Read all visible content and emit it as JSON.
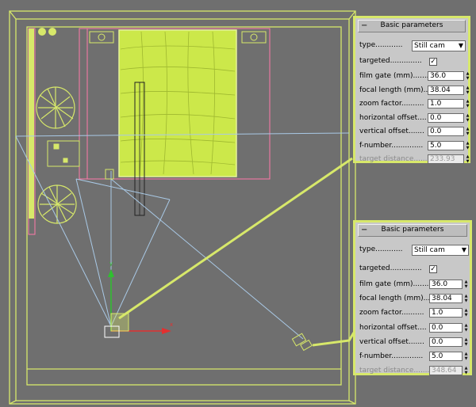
{
  "colors": {
    "viewport_bg": "#6f6f6f",
    "selection_outline": "#d7e86a",
    "scene_lime": "#cce84a",
    "camera_line": "#a9c9e6",
    "wall_outline": "#ff7aa8",
    "panel_bg": "#c8c8c8"
  },
  "panels": [
    {
      "collapse_symbol": "−",
      "title": "Basic parameters",
      "type_label": "type............",
      "type_value": "Still cam",
      "targeted_label": "targeted..............",
      "targeted_checked": true,
      "check_glyph": "✓",
      "fields": [
        {
          "label": "film gate (mm).......",
          "value": "36.0",
          "disabled": false
        },
        {
          "label": "focal length (mm)....",
          "value": "38.04",
          "disabled": false
        },
        {
          "label": "zoom factor..........",
          "value": "1.0",
          "disabled": false
        },
        {
          "label": "horizontal offset....",
          "value": "0.0",
          "disabled": false
        },
        {
          "label": "vertical offset.......",
          "value": "0.0",
          "disabled": false
        },
        {
          "label": "f-number..............",
          "value": "5.0",
          "disabled": false
        },
        {
          "label": "target distance.......",
          "value": "233.93",
          "disabled": true
        }
      ]
    },
    {
      "collapse_symbol": "−",
      "title": "Basic parameters",
      "type_label": "type............",
      "type_value": "Still cam",
      "targeted_label": "targeted..............",
      "targeted_checked": true,
      "check_glyph": "✓",
      "fields": [
        {
          "label": "film gate (mm).......",
          "value": "36.0",
          "disabled": false
        },
        {
          "label": "focal length (mm)....",
          "value": "38.04",
          "disabled": false
        },
        {
          "label": "zoom factor..........",
          "value": "1.0",
          "disabled": false
        },
        {
          "label": "horizontal offset....",
          "value": "0.0",
          "disabled": false
        },
        {
          "label": "vertical offset.......",
          "value": "0.0",
          "disabled": false
        },
        {
          "label": "f-number..............",
          "value": "5.0",
          "disabled": false
        },
        {
          "label": "target distance.......",
          "value": "348.64",
          "disabled": true
        }
      ]
    }
  ]
}
